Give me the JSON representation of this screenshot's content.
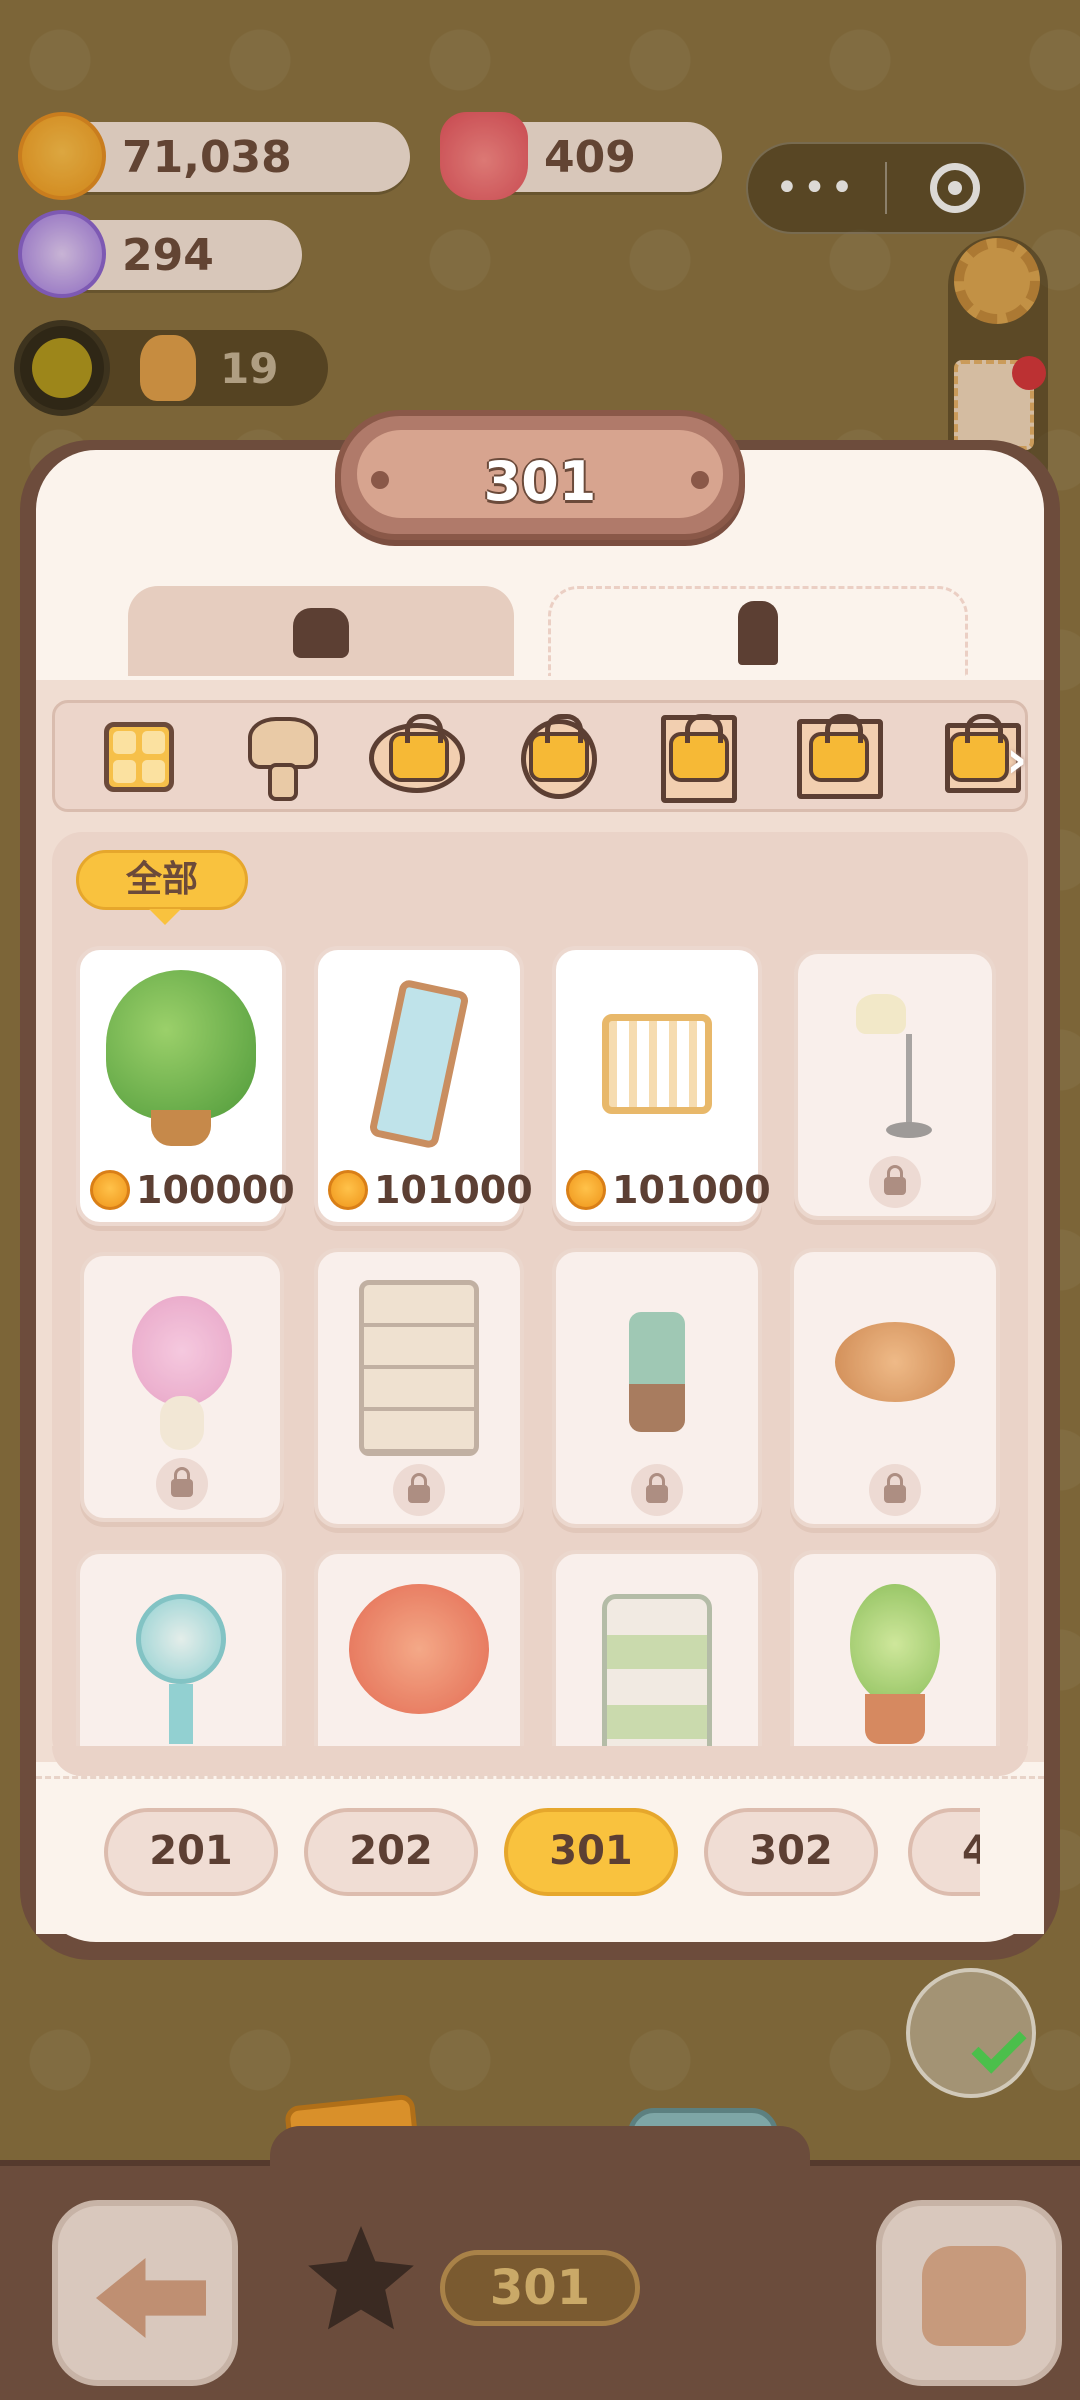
{
  "currencies": {
    "cookies": "71,038",
    "candles": "409",
    "candy": "294"
  },
  "timer": {
    "count": "19"
  },
  "capsule": {
    "menu_icon": "more-dots-icon",
    "close_icon": "target-icon"
  },
  "modal": {
    "title": "301"
  },
  "tabs": [
    {
      "icon": "armchair-icon",
      "selected": false
    },
    {
      "icon": "brush-icon",
      "selected": true
    }
  ],
  "categories": [
    {
      "icon": "grid-all-icon",
      "locked": false
    },
    {
      "icon": "lamp-icon",
      "locked": false
    },
    {
      "icon": "rug-icon",
      "locked": true
    },
    {
      "icon": "clock-icon",
      "locked": true
    },
    {
      "icon": "frame-icon",
      "locked": true
    },
    {
      "icon": "window-icon",
      "locked": true
    },
    {
      "icon": "cabinet-icon",
      "locked": true
    }
  ],
  "filter": {
    "label": "全部"
  },
  "items": [
    {
      "name": "potted-plant",
      "price": "100000",
      "locked": false
    },
    {
      "name": "floor-mirror",
      "price": "101000",
      "locked": false
    },
    {
      "name": "wooden-crib",
      "price": "101000",
      "locked": false
    },
    {
      "name": "floor-lamp",
      "price": "",
      "locked": true
    },
    {
      "name": "cherry-blossom-vase",
      "price": "",
      "locked": true
    },
    {
      "name": "display-shelf",
      "price": "",
      "locked": true
    },
    {
      "name": "umbrella-stand",
      "price": "",
      "locked": true
    },
    {
      "name": "bread-basket",
      "price": "",
      "locked": true
    },
    {
      "name": "electric-fan",
      "price": "",
      "locked": true
    },
    {
      "name": "maple-tree",
      "price": "",
      "locked": true
    },
    {
      "name": "drawer-cabinet",
      "price": "",
      "locked": true
    },
    {
      "name": "money-plant",
      "price": "",
      "locked": true
    }
  ],
  "rooms": [
    "201",
    "202",
    "301",
    "302",
    "4"
  ],
  "selected_room": "301",
  "bottom": {
    "room_label": "301"
  },
  "colors": {
    "accent": "#f9c23e",
    "frame": "#6d4c3c",
    "background": "#8a7240"
  }
}
